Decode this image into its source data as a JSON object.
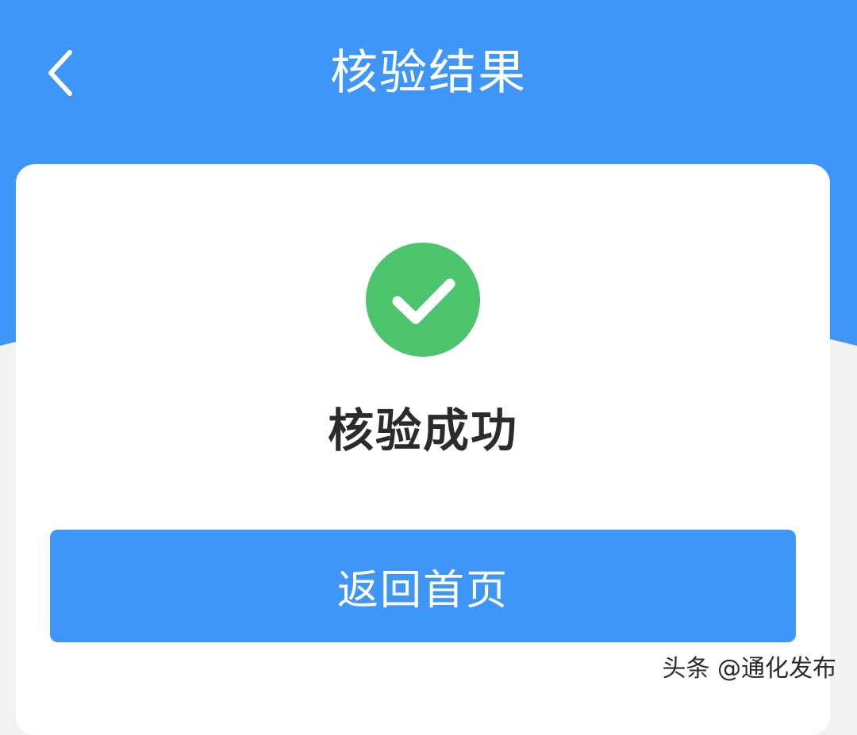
{
  "header": {
    "title": "核验结果",
    "back_icon": "chevron-left-icon",
    "background_color": "#3d96f8"
  },
  "result": {
    "status_icon": "check-circle-icon",
    "status_icon_color": "#4cc46c",
    "status_text": "核验成功"
  },
  "actions": {
    "home_button_label": "返回首页",
    "button_color": "#3d96f8"
  },
  "watermark": {
    "text": "头条 @通化发布"
  },
  "colors": {
    "page_background": "#f2f2f2",
    "card_background": "#ffffff",
    "text_primary": "#2b2b2b"
  }
}
